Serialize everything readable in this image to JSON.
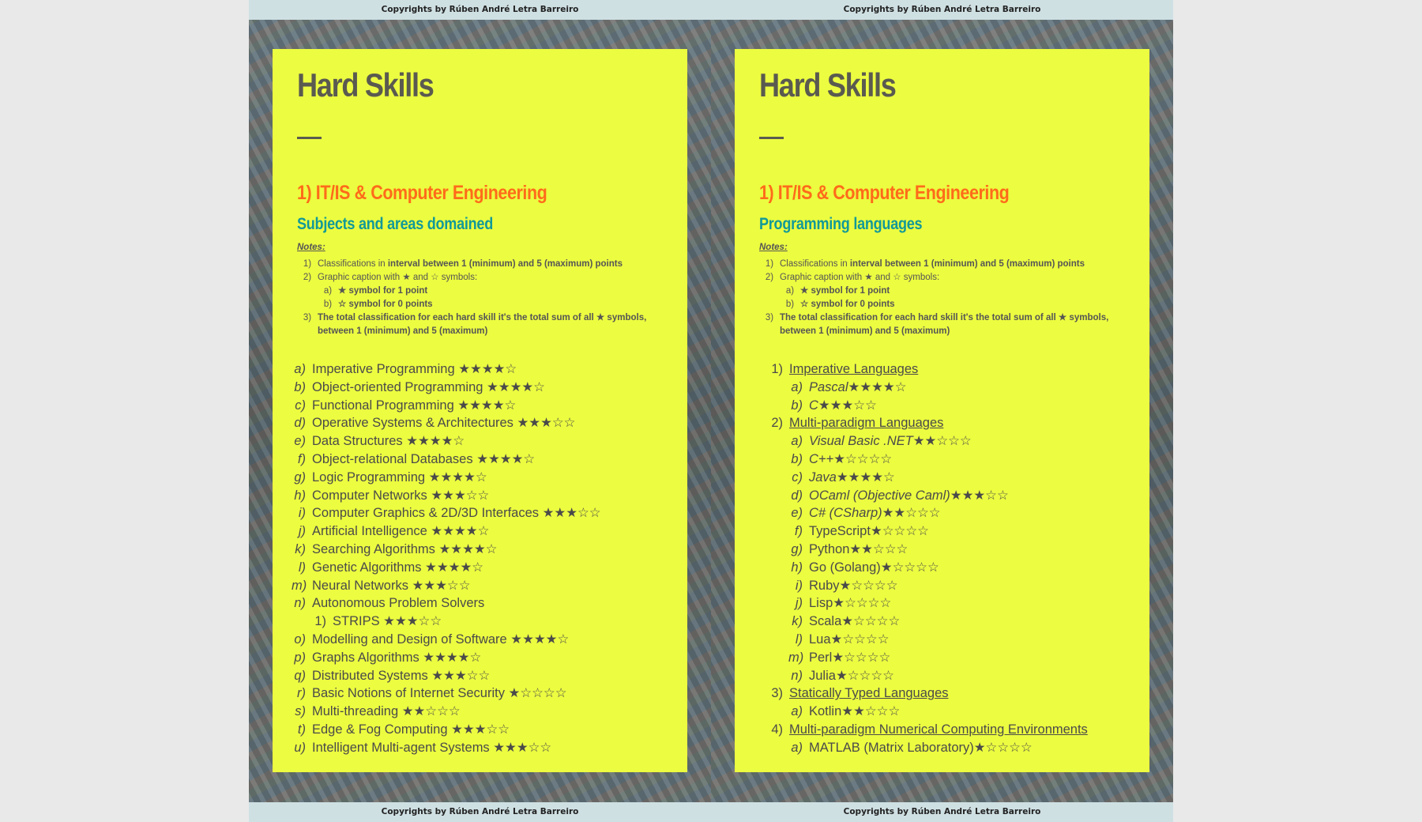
{
  "copyright": "Copyrights by Rúben André Letra Barreiro",
  "left": {
    "title": "Hard Skills",
    "section": "1) IT/IS & Computer Engineering",
    "subtitle": "Subjects and areas domained",
    "notes": {
      "heading": "Notes:",
      "n1_num": "1)",
      "n1_pre": "Classifications in ",
      "n1_bold": "interval between 1 (minimum) and 5 (maximum) points",
      "n2_num": "2)",
      "n2_text": "Graphic caption with ★ and ☆ symbols:",
      "n2a_num": "a)",
      "n2a_text": "★ symbol for 1 point",
      "n2b_num": "b)",
      "n2b_text": "☆ symbol for 0 points",
      "n3_num": "3)",
      "n3_text": "The total classification for each hard skill it's the total sum of all ★ symbols, between 1 (minimum) and 5 (maximum)"
    },
    "items": [
      {
        "label": "a)",
        "text": "Imperative Programming ★★★★☆"
      },
      {
        "label": "b)",
        "text": "Object-oriented Programming ★★★★☆"
      },
      {
        "label": "c)",
        "text": "Functional Programming ★★★★☆"
      },
      {
        "label": "d)",
        "text": "Operative Systems & Architectures ★★★☆☆"
      },
      {
        "label": "e)",
        "text": "Data Structures ★★★★☆"
      },
      {
        "label": "f)",
        "text": "Object-relational Databases ★★★★☆"
      },
      {
        "label": "g)",
        "text": "Logic Programming ★★★★☆"
      },
      {
        "label": "h)",
        "text": "Computer Networks ★★★☆☆"
      },
      {
        "label": "i)",
        "text": "Computer Graphics & 2D/3D Interfaces ★★★☆☆"
      },
      {
        "label": "j)",
        "text": "Artificial Intelligence ★★★★☆"
      },
      {
        "label": "k)",
        "text": "Searching Algorithms ★★★★☆"
      },
      {
        "label": "l)",
        "text": "Genetic Algorithms ★★★★☆"
      },
      {
        "label": "m)",
        "text": "Neural Networks ★★★☆☆"
      },
      {
        "label": "n)",
        "text": "Autonomous Problem Solvers"
      },
      {
        "sub_label": "1)",
        "sub_text": "STRIPS  ★★★☆☆"
      },
      {
        "label": "o)",
        "text": "Modelling and Design of Software ★★★★☆"
      },
      {
        "label": "p)",
        "text": "Graphs Algorithms ★★★★☆"
      },
      {
        "label": "q)",
        "text": "Distributed Systems ★★★☆☆"
      },
      {
        "label": "r)",
        "text": "Basic Notions of Internet Security ★☆☆☆☆"
      },
      {
        "label": "s)",
        "text": "Multi-threading ★★☆☆☆"
      },
      {
        "label": "t)",
        "text": "Edge & Fog Computing ★★★☆☆"
      },
      {
        "label": "u)",
        "text": "Intelligent Multi-agent Systems ★★★☆☆"
      }
    ]
  },
  "right": {
    "title": "Hard Skills",
    "section": "1) IT/IS & Computer Engineering",
    "subtitle": "Programming languages",
    "groups": [
      {
        "num": "1)",
        "name": "Imperative Languages",
        "items": [
          {
            "label": "a)",
            "name": "Pascal",
            "stars": "★★★★☆"
          },
          {
            "label": "b)",
            "name": "C",
            "stars": "★★★☆☆"
          }
        ]
      },
      {
        "num": "2)",
        "name": "Multi-paradigm Languages",
        "items": [
          {
            "label": "a)",
            "name": "Visual Basic .NET",
            "stars": "★★☆☆☆"
          },
          {
            "label": "b)",
            "name": "C++",
            "stars": "★☆☆☆☆"
          },
          {
            "label": "c)",
            "name": "Java",
            "stars": "★★★★☆"
          },
          {
            "label": "d)",
            "name": "OCaml (Objective Caml)",
            "stars": "★★★☆☆"
          },
          {
            "label": "e)",
            "name": "C# (CSharp)",
            "stars": "★★☆☆☆"
          },
          {
            "label": "f)",
            "name": "TypeScript",
            "stars": "★☆☆☆☆"
          },
          {
            "label": "g)",
            "name": "Python",
            "stars": "★★☆☆☆"
          },
          {
            "label": "h)",
            "name": "Go (Golang)",
            "stars": "★☆☆☆☆"
          },
          {
            "label": "i)",
            "name": "Ruby",
            "stars": "★☆☆☆☆"
          },
          {
            "label": "j)",
            "name": "Lisp",
            "stars": "★☆☆☆☆"
          },
          {
            "label": "k)",
            "name": "Scala",
            "stars": "★☆☆☆☆"
          },
          {
            "label": "l)",
            "name": "Lua",
            "stars": "★☆☆☆☆"
          },
          {
            "label": "m)",
            "name": "Perl",
            "stars": "★☆☆☆☆"
          },
          {
            "label": "n)",
            "name": "Julia",
            "stars": "★☆☆☆☆"
          }
        ]
      },
      {
        "num": "3)",
        "name": "Statically Typed Languages",
        "items": [
          {
            "label": "a)",
            "name": "Kotlin",
            "stars": "★★☆☆☆"
          }
        ]
      },
      {
        "num": "4)",
        "name": "Multi-paradigm Numerical Computing Environments",
        "items": [
          {
            "label": "a)",
            "name": "MATLAB (Matrix Laboratory)",
            "stars": "★☆☆☆☆"
          }
        ]
      }
    ]
  }
}
